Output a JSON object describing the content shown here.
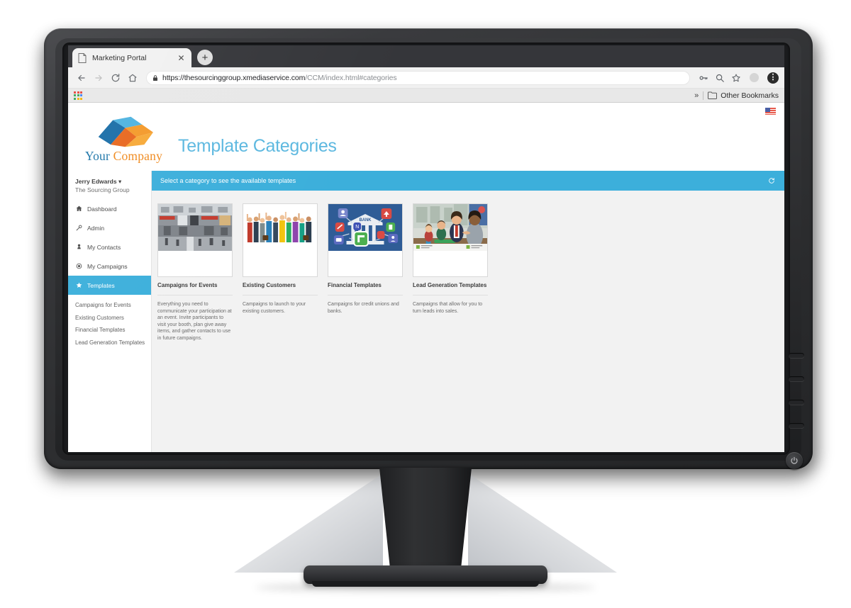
{
  "browser": {
    "tab": {
      "title": "Marketing Portal",
      "favicon_icon": "page-icon",
      "close_icon": "close-icon"
    },
    "new_tab_label": "+",
    "nav": {
      "back_icon": "back-arrow-icon",
      "forward_icon": "forward-arrow-icon",
      "reload_icon": "reload-icon",
      "home_icon": "home-icon"
    },
    "omnibox": {
      "lock_icon": "lock-icon",
      "url_scheme_host": "https://thesourcinggroup.xmediaservice.com",
      "url_path": "/CCM/index.html#categories",
      "full_url": "https://thesourcinggroup.xmediaservice.com/CCM/index.html#categories"
    },
    "actions": {
      "password_icon": "key-icon",
      "search_icon": "search-icon",
      "bookmark_icon": "star-icon",
      "profile_icon": "avatar-icon",
      "menu_icon": "more-menu-icon"
    },
    "bookmarks_bar": {
      "apps_icon": "apps-grid-icon",
      "overflow_label": "»",
      "folder_icon": "folder-icon",
      "folder_label": "Other Bookmarks"
    }
  },
  "app": {
    "brand": {
      "logo_icon": "company-logo-icon",
      "name_part1": "Your",
      "name_part2": "Company"
    },
    "page_title": "Template Categories",
    "locale_flag_icon": "us-flag-icon",
    "banner": {
      "text": "Select a category to see the available templates",
      "refresh_icon": "refresh-icon"
    },
    "sidebar": {
      "user_name": "Jerry Edwards",
      "user_caret": "▾",
      "user_org": "The Sourcing Group",
      "items": [
        {
          "label": "Dashboard",
          "icon": "dashboard-icon",
          "active": false
        },
        {
          "label": "Admin",
          "icon": "wrench-icon",
          "active": false
        },
        {
          "label": "My Contacts",
          "icon": "person-icon",
          "active": false
        },
        {
          "label": "My Campaigns",
          "icon": "target-icon",
          "active": false
        },
        {
          "label": "Templates",
          "icon": "star-icon",
          "active": true
        }
      ],
      "subitems": [
        {
          "label": "Campaigns for Events"
        },
        {
          "label": "Existing Customers"
        },
        {
          "label": "Financial Templates"
        },
        {
          "label": "Lead Generation Templates"
        }
      ]
    },
    "cards": [
      {
        "title": "Campaigns for Events",
        "description": "Everything you need to communicate your participation at an event. Invite participants to visit your booth, plan give away items, and gather contacts to use in future campaigns.",
        "thumb_icon": "trade-show-photo"
      },
      {
        "title": "Existing Customers",
        "description": "Campaigns to launch to your existing customers.",
        "thumb_icon": "crowd-of-people-photo"
      },
      {
        "title": "Financial Templates",
        "description": "Campaigns for credit unions and banks.",
        "thumb_icon": "bank-illustration"
      },
      {
        "title": "Lead Generation Templates",
        "description": "Campaigns that allow for you to turn leads into sales.",
        "thumb_icon": "business-meeting-photo"
      }
    ]
  },
  "colors": {
    "accent_blue": "#3cafdb",
    "title_blue": "#5cb8e0",
    "brand_blue": "#1b74a8",
    "brand_orange": "#f08a1e",
    "page_bg": "#f2f2f2"
  },
  "device": {
    "power_icon": "power-icon",
    "bezel_button_count": 4
  }
}
